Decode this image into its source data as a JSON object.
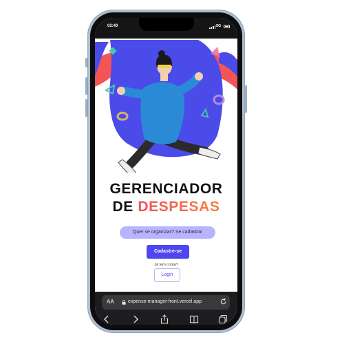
{
  "status": {
    "time": "02:40",
    "network": "5G"
  },
  "main": {
    "title_line1": "GERENCIADOR",
    "title_line2_prefix": "DE ",
    "title_line2_accent": "DESPESAS",
    "prompt": "Quer se organizar? Se cadastra!",
    "signup_label": "Cadastre-se",
    "login_question": "Já tem conta?",
    "login_label": "Login"
  },
  "browser": {
    "text_size_label": "AA",
    "url": "expense-manager-front.vercel.app"
  },
  "colors": {
    "accent": "#4f46f0",
    "accent_light": "#b8b4ff",
    "title_gradient_start": "#ef4f5f",
    "title_gradient_end": "#f6823f"
  },
  "icons": {
    "back": "chevron-left-icon",
    "forward": "chevron-right-icon",
    "share": "share-icon",
    "bookmarks": "book-icon",
    "tabs": "tabs-icon",
    "reload": "reload-icon",
    "lock": "lock-icon"
  }
}
